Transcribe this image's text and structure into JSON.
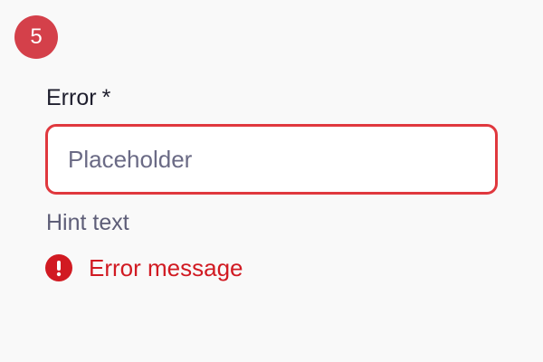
{
  "step": {
    "number": "5",
    "color": "#d4404a"
  },
  "field": {
    "label": "Error",
    "required_marker": "*",
    "placeholder": "Placeholder",
    "value": "",
    "border_color": "#e0383e",
    "hint": "Hint text",
    "error": {
      "icon": "exclamation-circle-icon",
      "message": "Error message",
      "color": "#d11a22"
    }
  }
}
